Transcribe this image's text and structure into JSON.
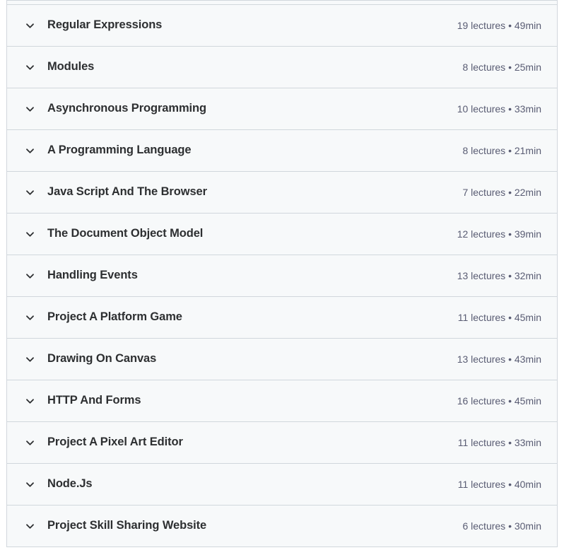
{
  "accordion": {
    "background_color": "#f7f9fa",
    "border_color": "#d1d7dc",
    "title_color": "#2d2f31",
    "meta_color": "#595c73",
    "chevron_icon": "chevron-down-icon",
    "meta_separator": "•",
    "lectures_unit": "lectures",
    "duration_unit": "min",
    "sections": [
      {
        "title": "Regular Expressions",
        "lectures": "19 lectures",
        "duration": "49min",
        "meta": "19 lectures • 49min",
        "expanded": false
      },
      {
        "title": "Modules",
        "lectures": "8 lectures",
        "duration": "25min",
        "meta": "8 lectures • 25min",
        "expanded": false
      },
      {
        "title": "Asynchronous Programming",
        "lectures": "10 lectures",
        "duration": "33min",
        "meta": "10 lectures • 33min",
        "expanded": false
      },
      {
        "title": "A Programming Language",
        "lectures": "8 lectures",
        "duration": "21min",
        "meta": "8 lectures • 21min",
        "expanded": false
      },
      {
        "title": "Java Script And The Browser",
        "lectures": "7 lectures",
        "duration": "22min",
        "meta": "7 lectures • 22min",
        "expanded": false
      },
      {
        "title": "The Document Object Model",
        "lectures": "12 lectures",
        "duration": "39min",
        "meta": "12 lectures • 39min",
        "expanded": false
      },
      {
        "title": "Handling Events",
        "lectures": "13 lectures",
        "duration": "32min",
        "meta": "13 lectures • 32min",
        "expanded": false
      },
      {
        "title": "Project A Platform Game",
        "lectures": "11 lectures",
        "duration": "45min",
        "meta": "11 lectures • 45min",
        "expanded": false
      },
      {
        "title": "Drawing On Canvas",
        "lectures": "13 lectures",
        "duration": "43min",
        "meta": "13 lectures • 43min",
        "expanded": false
      },
      {
        "title": "HTTP And Forms",
        "lectures": "16 lectures",
        "duration": "45min",
        "meta": "16 lectures • 45min",
        "expanded": false
      },
      {
        "title": "Project A Pixel Art Editor",
        "lectures": "11 lectures",
        "duration": "33min",
        "meta": "11 lectures • 33min",
        "expanded": false
      },
      {
        "title": "Node.Js",
        "lectures": "11 lectures",
        "duration": "40min",
        "meta": "11 lectures • 40min",
        "expanded": false
      },
      {
        "title": "Project Skill Sharing Website",
        "lectures": "6 lectures",
        "duration": "30min",
        "meta": "6 lectures • 30min",
        "expanded": false
      }
    ]
  }
}
